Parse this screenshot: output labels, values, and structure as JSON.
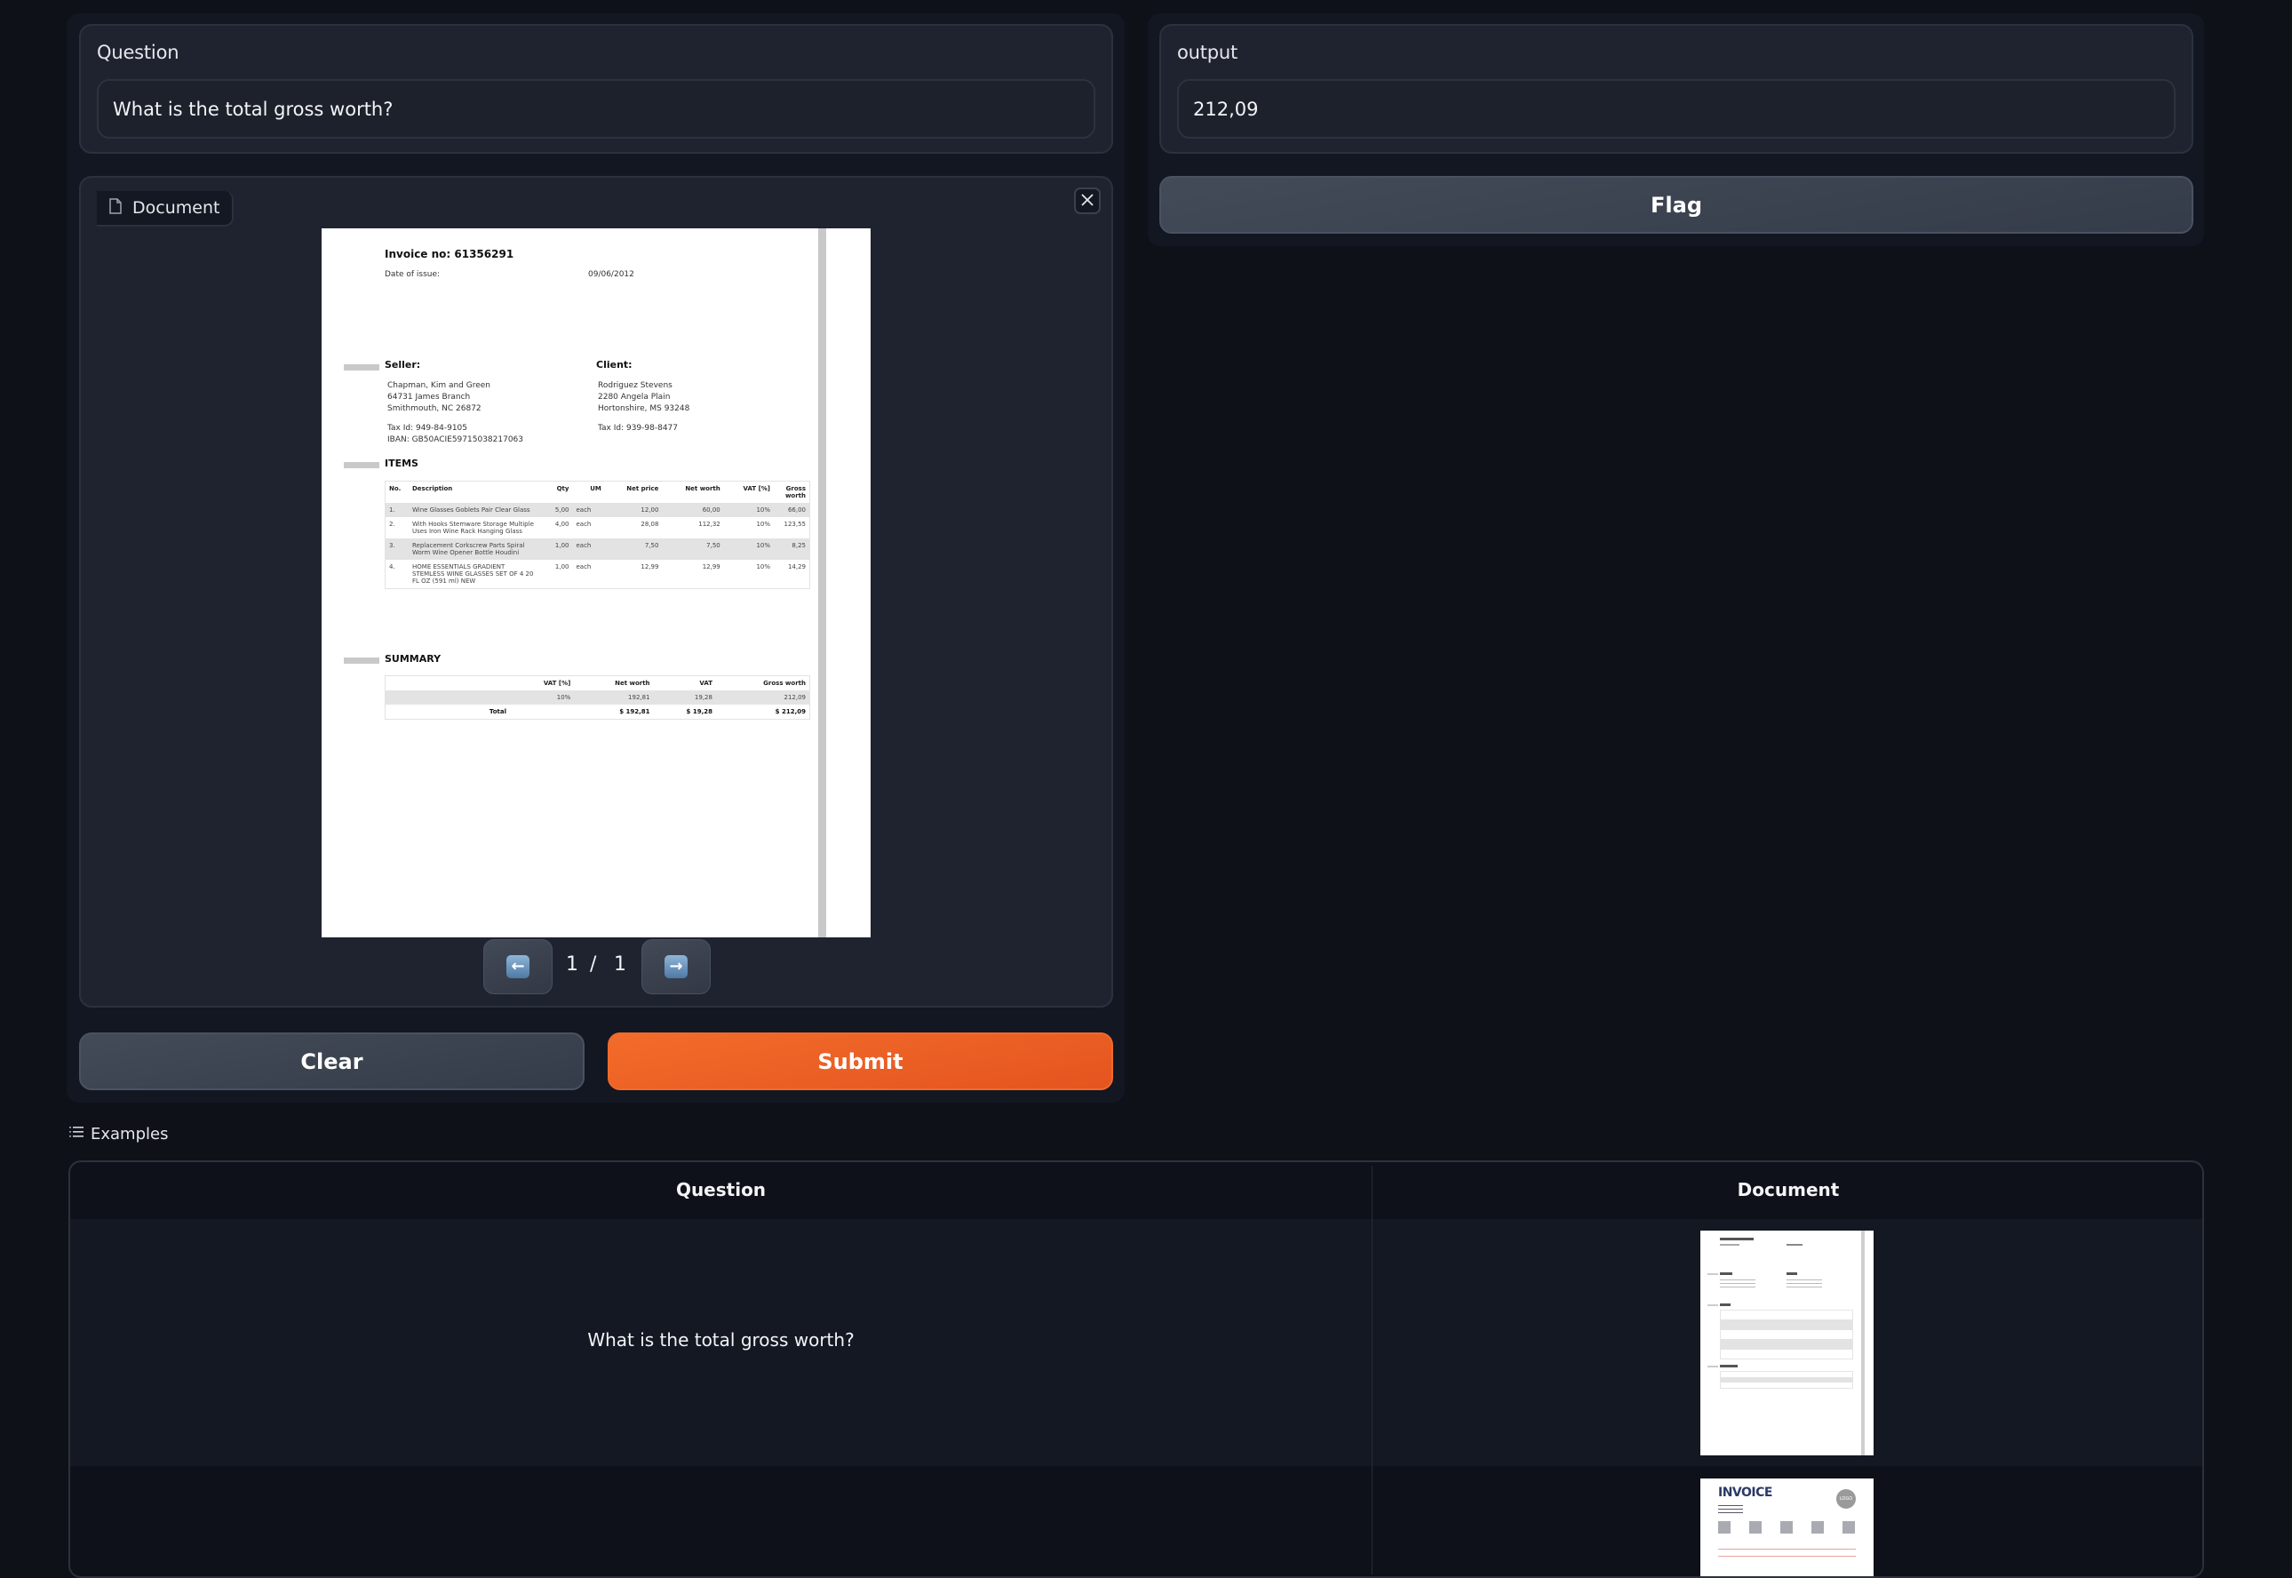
{
  "question": {
    "label": "Question",
    "value": "What is the total gross worth?"
  },
  "document": {
    "label": "Document",
    "close_label": "×",
    "icon": "file-icon",
    "pagination": {
      "prev_icon": "left-arrow-icon",
      "next_icon": "right-arrow-icon",
      "current": "1",
      "separator": "/",
      "total": "1"
    },
    "invoice": {
      "title": "Invoice no: 61356291",
      "date_label": "Date of issue:",
      "date_value": "09/06/2012",
      "seller_heading": "Seller:",
      "seller_lines": [
        "Chapman, Kim and Green",
        "64731 James Branch",
        "Smithmouth, NC 26872"
      ],
      "seller_tax": "Tax Id: 949-84-9105",
      "seller_iban": "IBAN: GB50ACIE59715038217063",
      "client_heading": "Client:",
      "client_lines": [
        "Rodriguez Stevens",
        "2280 Angela Plain",
        "Hortonshire, MS 93248"
      ],
      "client_tax": "Tax Id: 939-98-8477",
      "items_heading": "ITEMS",
      "items_columns": [
        "No.",
        "Description",
        "Qty",
        "UM",
        "Net price",
        "Net worth",
        "VAT [%]",
        "Gross worth"
      ],
      "items": [
        {
          "no": "1.",
          "description": "Wine Glasses Goblets Pair Clear Glass",
          "qty": "5,00",
          "um": "each",
          "net_price": "12,00",
          "net_worth": "60,00",
          "vat": "10%",
          "gross": "66,00"
        },
        {
          "no": "2.",
          "description": "With Hooks Stemware Storage Multiple Uses Iron Wine Rack Hanging Glass",
          "qty": "4,00",
          "um": "each",
          "net_price": "28,08",
          "net_worth": "112,32",
          "vat": "10%",
          "gross": "123,55"
        },
        {
          "no": "3.",
          "description": "Replacement Corkscrew Parts Spiral Worm Wine Opener Bottle Houdini",
          "qty": "1,00",
          "um": "each",
          "net_price": "7,50",
          "net_worth": "7,50",
          "vat": "10%",
          "gross": "8,25"
        },
        {
          "no": "4.",
          "description": "HOME ESSENTIALS GRADIENT STEMLESS WINE GLASSES SET OF 4 20 FL OZ (591 ml) NEW",
          "qty": "1,00",
          "um": "each",
          "net_price": "12,99",
          "net_worth": "12,99",
          "vat": "10%",
          "gross": "14,29"
        }
      ],
      "summary_heading": "SUMMARY",
      "summary_columns": [
        "VAT [%]",
        "Net worth",
        "VAT",
        "Gross worth"
      ],
      "summary_row": {
        "vat_rate": "10%",
        "net": "192,81",
        "vat": "19,28",
        "gross": "212,09"
      },
      "summary_total": {
        "label": "Total",
        "net": "$ 192,81",
        "vat": "$ 19,28",
        "gross": "$ 212,09"
      }
    }
  },
  "actions": {
    "clear_label": "Clear",
    "submit_label": "Submit"
  },
  "output": {
    "label": "output",
    "value": "212,09",
    "flag_label": "Flag"
  },
  "examples": {
    "label": "Examples",
    "icon": "list-icon",
    "columns": [
      "Question",
      "Document"
    ],
    "rows": [
      {
        "question": "What is the total gross worth?",
        "document_thumb": "invoice-61356291"
      },
      {
        "question": "",
        "document_thumb": "invoice-template"
      }
    ],
    "thumb2_title": "INVOICE",
    "thumb2_logo": "LOGO"
  },
  "colors": {
    "background": "#0f1119",
    "panel": "#1f2330",
    "primary": "#f0622a",
    "secondary": "#3c4350"
  }
}
